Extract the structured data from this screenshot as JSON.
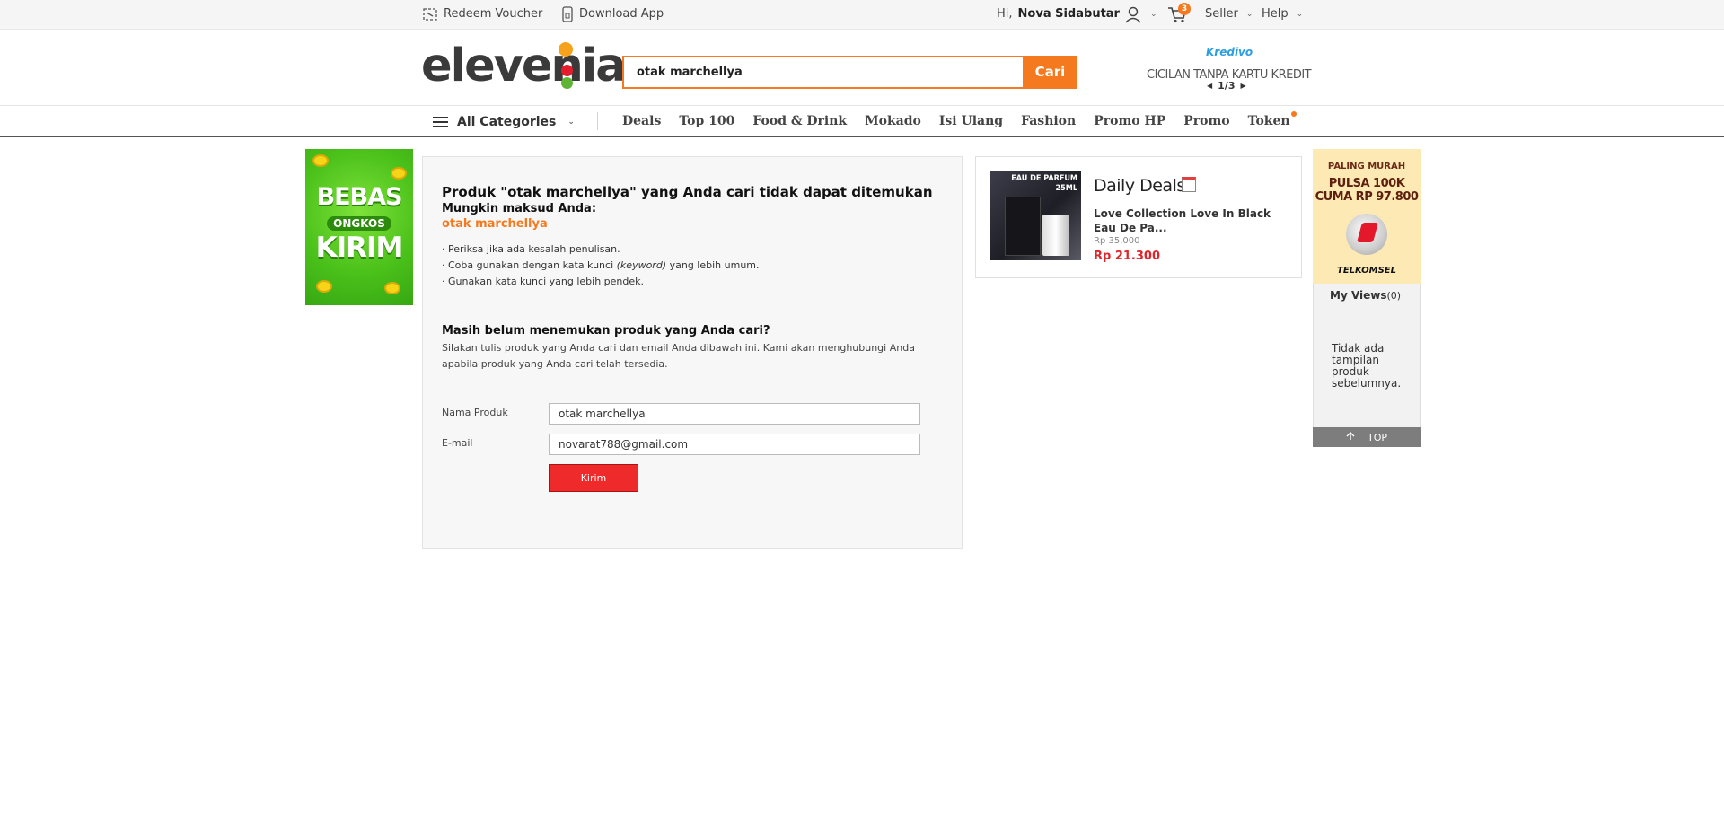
{
  "topbar": {
    "redeem_label": "Redeem Voucher",
    "download_label": "Download App",
    "greeting": "Hi,",
    "user_name": "Nova Sidabutar",
    "cart_count": "3",
    "seller_label": "Seller",
    "help_label": "Help"
  },
  "header": {
    "logo_text": "elevenia",
    "search_value": "otak marchellya",
    "search_button": "Cari",
    "promo_brand": "Kredivo",
    "promo_text": "CICILAN TANPA KARTU KREDIT",
    "promo_pager": "1/3"
  },
  "nav": {
    "all_categories": "All Categories",
    "links": [
      "Deals",
      "Top 100",
      "Food & Drink",
      "Mokado",
      "Isi Ulang",
      "Fashion",
      "Promo HP",
      "Promo",
      "Token"
    ]
  },
  "left_banner": {
    "line1": "BEBAS",
    "line2": "ONGKOS",
    "line3": "KIRIM"
  },
  "main": {
    "not_found_title": "Produk \"otak marchellya\" yang Anda cari tidak dapat ditemukan",
    "suggest_label": "Mungkin maksud Anda:",
    "suggest_value": "otak marchellya",
    "tip1": "· Periksa jika ada kesalah penulisan.",
    "tip2_a": "· Coba gunakan dengan kata kunci ",
    "tip2_b": "(keyword)",
    "tip2_c": " yang lebih umum.",
    "tip3": "· Gunakan kata kunci yang lebih pendek.",
    "request_title": "Masih belum menemukan produk yang Anda cari?",
    "request_desc": "Silakan tulis produk yang Anda cari dan email Anda dibawah ini. Kami akan menghubungi Anda apabila produk yang Anda cari telah tersedia.",
    "product_label": "Nama Produk",
    "product_value": "otak marchellya",
    "email_label": "E-mail",
    "email_value": "novarat788@gmail.com",
    "submit_label": "Kirim"
  },
  "deals": {
    "title": "Daily Deals",
    "image_text": "EAU DE PARFUM 25ML",
    "product_name": "Love Collection Love In Black Eau De Pa...",
    "old_price": "Rp 35.000",
    "new_price": "Rp 21.300"
  },
  "right": {
    "banner_tag": "PALING MURAH",
    "banner_headline1": "PULSA 100K",
    "banner_headline2": "CUMA RP 97.800",
    "banner_brand": "TELKOMSEL",
    "myviews_title": "My Views",
    "myviews_count": "(0)",
    "myviews_empty": "Tidak ada tampilan produk sebelumnya.",
    "top_label": "TOP"
  }
}
